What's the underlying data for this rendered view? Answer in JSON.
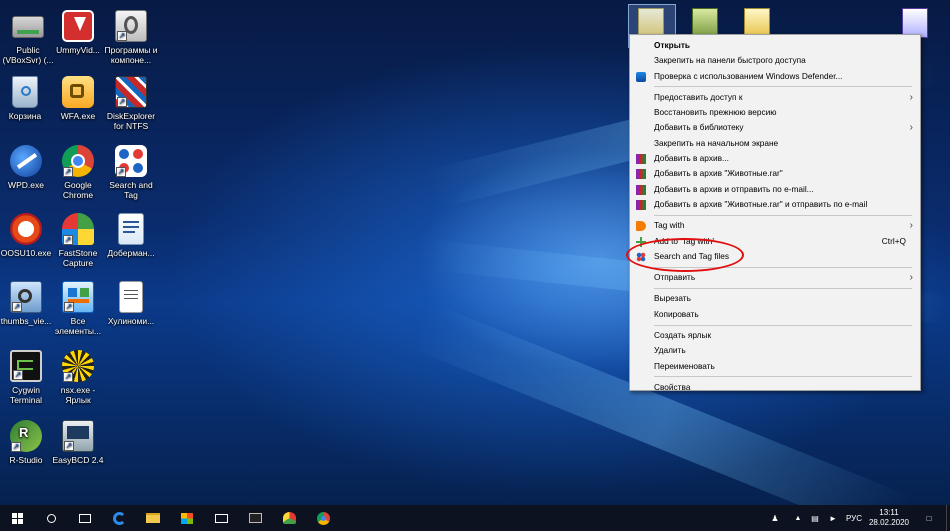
{
  "desktop": {
    "icons": [
      {
        "label": "Public (VBoxSvr) (...",
        "icon": "network-drive-icon"
      },
      {
        "label": "UmmyVid...",
        "icon": "ummy-download-icon"
      },
      {
        "label": "Программы и компоне...",
        "icon": "programs-features-icon"
      },
      {
        "label": "Корзина",
        "icon": "recycle-bin-icon"
      },
      {
        "label": "WFA.exe",
        "icon": "wfa-icon"
      },
      {
        "label": "DiskExplorer for NTFS",
        "icon": "disk-explorer-icon"
      },
      {
        "label": "WPD.exe",
        "icon": "wpd-icon"
      },
      {
        "label": "Google Chrome",
        "icon": "chrome-icon"
      },
      {
        "label": "Search and Tag",
        "icon": "search-and-tag-icon"
      },
      {
        "label": "OOSU10.exe",
        "icon": "oosu-icon"
      },
      {
        "label": "FastStone Capture",
        "icon": "faststone-icon"
      },
      {
        "label": "Доберман...",
        "icon": "document-icon"
      },
      {
        "label": "thumbs_vie...",
        "icon": "thumbs-viewer-icon"
      },
      {
        "label": "Все элементы...",
        "icon": "control-panel-icon"
      },
      {
        "label": "Хулиноми...",
        "icon": "text-file-icon"
      },
      {
        "label": "Cygwin Terminal",
        "icon": "terminal-icon"
      },
      {
        "label": "nsx.exe - Ярлык",
        "icon": "nsx-icon"
      },
      {
        "label": "R-Studio",
        "icon": "r-studio-icon"
      },
      {
        "label": "EasyBCD 2.4",
        "icon": "easybcd-icon"
      }
    ]
  },
  "context_menu": {
    "items": [
      {
        "label": "Открыть",
        "bold": true
      },
      {
        "label": "Закрепить на панели быстрого доступа"
      },
      {
        "label": "Проверка с использованием Windows Defender...",
        "icon": "windows-defender-icon"
      },
      {
        "sep": true
      },
      {
        "label": "Предоставить доступ к",
        "submenu": true
      },
      {
        "label": "Восстановить прежнюю версию"
      },
      {
        "label": "Добавить в библиотеку",
        "submenu": true
      },
      {
        "label": "Закрепить на начальном экране"
      },
      {
        "label": "Добавить в архив...",
        "icon": "winrar-icon"
      },
      {
        "label": "Добавить в архив \"Животные.rar\"",
        "icon": "winrar-icon"
      },
      {
        "label": "Добавить в архив и отправить по e-mail...",
        "icon": "winrar-icon"
      },
      {
        "label": "Добавить в архив \"Животные.rar\" и отправить по e-mail",
        "icon": "winrar-icon"
      },
      {
        "sep": true
      },
      {
        "label": "Tag with",
        "icon": "tag-icon",
        "submenu": true
      },
      {
        "label": "Add to 'Tag with'",
        "icon": "add-icon",
        "shortcut": "Ctrl+Q"
      },
      {
        "label": "Search and Tag files",
        "icon": "search-and-tag-icon"
      },
      {
        "sep": true
      },
      {
        "label": "Отправить",
        "submenu": true
      },
      {
        "sep": true
      },
      {
        "label": "Вырезать"
      },
      {
        "label": "Копировать"
      },
      {
        "sep": true
      },
      {
        "label": "Создать ярлык"
      },
      {
        "label": "Удалить"
      },
      {
        "label": "Переименовать"
      },
      {
        "sep": true
      },
      {
        "label": "Свойства"
      }
    ]
  },
  "taskbar": {
    "language": "РУС",
    "time": "13:11",
    "date": "28.02.2020"
  }
}
